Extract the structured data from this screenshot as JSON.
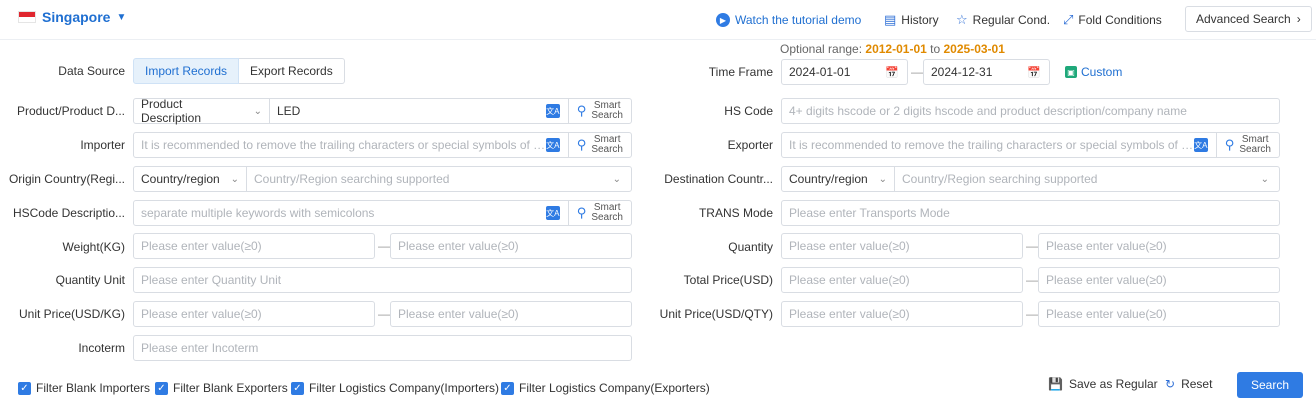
{
  "header": {
    "country": "Singapore",
    "links": {
      "tutorial": "Watch the tutorial demo",
      "history": "History",
      "regular": "Regular Cond.",
      "fold": "Fold Conditions",
      "advanced": "Advanced Search"
    }
  },
  "optional_range": {
    "label": "Optional range:",
    "start": "2012-01-01",
    "to": "to",
    "end": "2025-03-01"
  },
  "left": {
    "data_source": {
      "label": "Data Source",
      "options": [
        "Import Records",
        "Export Records"
      ],
      "selected": "Import Records"
    },
    "product": {
      "label": "Product/Product D...",
      "type": "Product Description",
      "value": "LED",
      "smart": [
        "Smart",
        "Search"
      ]
    },
    "importer": {
      "label": "Importer",
      "placeholder": "It is recommended to remove the trailing characters or special symbols of the...",
      "smart": [
        "Smart",
        "Search"
      ]
    },
    "origin": {
      "label": "Origin Country(Regi...",
      "type": "Country/region",
      "placeholder": "Country/Region searching supported"
    },
    "hscode_desc": {
      "label": "HSCode Descriptio...",
      "placeholder": "separate multiple keywords with semicolons",
      "smart": [
        "Smart",
        "Search"
      ]
    },
    "weight": {
      "label": "Weight(KG)",
      "placeholder_min": "Please enter value(≥0)",
      "placeholder_max": "Please enter value(≥0)"
    },
    "quantity_unit": {
      "label": "Quantity Unit",
      "placeholder": "Please enter Quantity Unit"
    },
    "unit_price_kg": {
      "label": "Unit Price(USD/KG)",
      "placeholder_min": "Please enter value(≥0)",
      "placeholder_max": "Please enter value(≥0)"
    },
    "incoterm": {
      "label": "Incoterm",
      "placeholder": "Please enter Incoterm"
    }
  },
  "right": {
    "time_frame": {
      "label": "Time Frame",
      "start": "2024-01-01",
      "end": "2024-12-31",
      "custom": "Custom"
    },
    "hs_code": {
      "label": "HS Code",
      "placeholder": "4+ digits hscode or 2 digits hscode and product description/company name"
    },
    "exporter": {
      "label": "Exporter",
      "placeholder": "It is recommended to remove the trailing characters or special symbols of the...",
      "smart": [
        "Smart",
        "Search"
      ]
    },
    "destination": {
      "label": "Destination Countr...",
      "type": "Country/region",
      "placeholder": "Country/Region searching supported"
    },
    "trans_mode": {
      "label": "TRANS Mode",
      "placeholder": "Please enter Transports Mode"
    },
    "quantity": {
      "label": "Quantity",
      "placeholder_min": "Please enter value(≥0)",
      "placeholder_max": "Please enter value(≥0)"
    },
    "total_price": {
      "label": "Total Price(USD)",
      "placeholder_min": "Please enter value(≥0)",
      "placeholder_max": "Please enter value(≥0)"
    },
    "unit_price_qty": {
      "label": "Unit Price(USD/QTY)",
      "placeholder_min": "Please enter value(≥0)",
      "placeholder_max": "Please enter value(≥0)"
    }
  },
  "filters": [
    "Filter Blank Importers",
    "Filter Blank Exporters",
    "Filter Logistics Company(Importers)",
    "Filter Logistics Company(Exporters)"
  ],
  "actions": {
    "save": "Save as Regular",
    "reset": "Reset",
    "search": "Search"
  },
  "colors": {
    "accent": "#2f7be3",
    "highlight_date": "#e08a00",
    "link": "#1f6fd1"
  }
}
